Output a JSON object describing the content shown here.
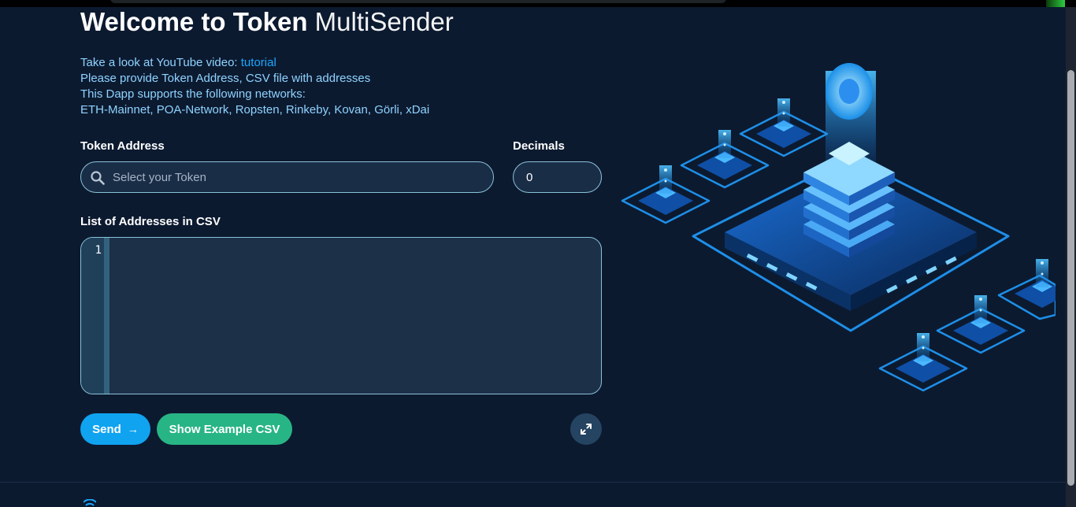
{
  "header": {
    "title_bold": "Welcome to Token",
    "title_light": "MultiSender"
  },
  "info": {
    "video_prefix": "Take a look at YouTube video: ",
    "video_link": "tutorial",
    "line2": "Please provide Token Address, CSV file with addresses",
    "line3": "This Dapp supports the following networks:",
    "line4": "ETH-Mainnet, POA-Network, Ropsten, Rinkeby, Kovan, Görli, xDai"
  },
  "form": {
    "token_label": "Token Address",
    "token_placeholder": "Select your Token",
    "decimals_label": "Decimals",
    "decimals_value": "0",
    "csv_label": "List of Addresses in CSV",
    "csv_line_number": "1"
  },
  "actions": {
    "send_label": "Send",
    "send_arrow": "→",
    "example_label": "Show Example CSV"
  },
  "icons": {
    "search": "search-icon",
    "expand": "expand-icon",
    "illustration": "server-network-illustration"
  },
  "colors": {
    "background": "#0c1a30",
    "accent_blue": "#10a3f0",
    "accent_green": "#28b585",
    "link": "#1aa7ff",
    "info_text": "#8fd3ff"
  }
}
